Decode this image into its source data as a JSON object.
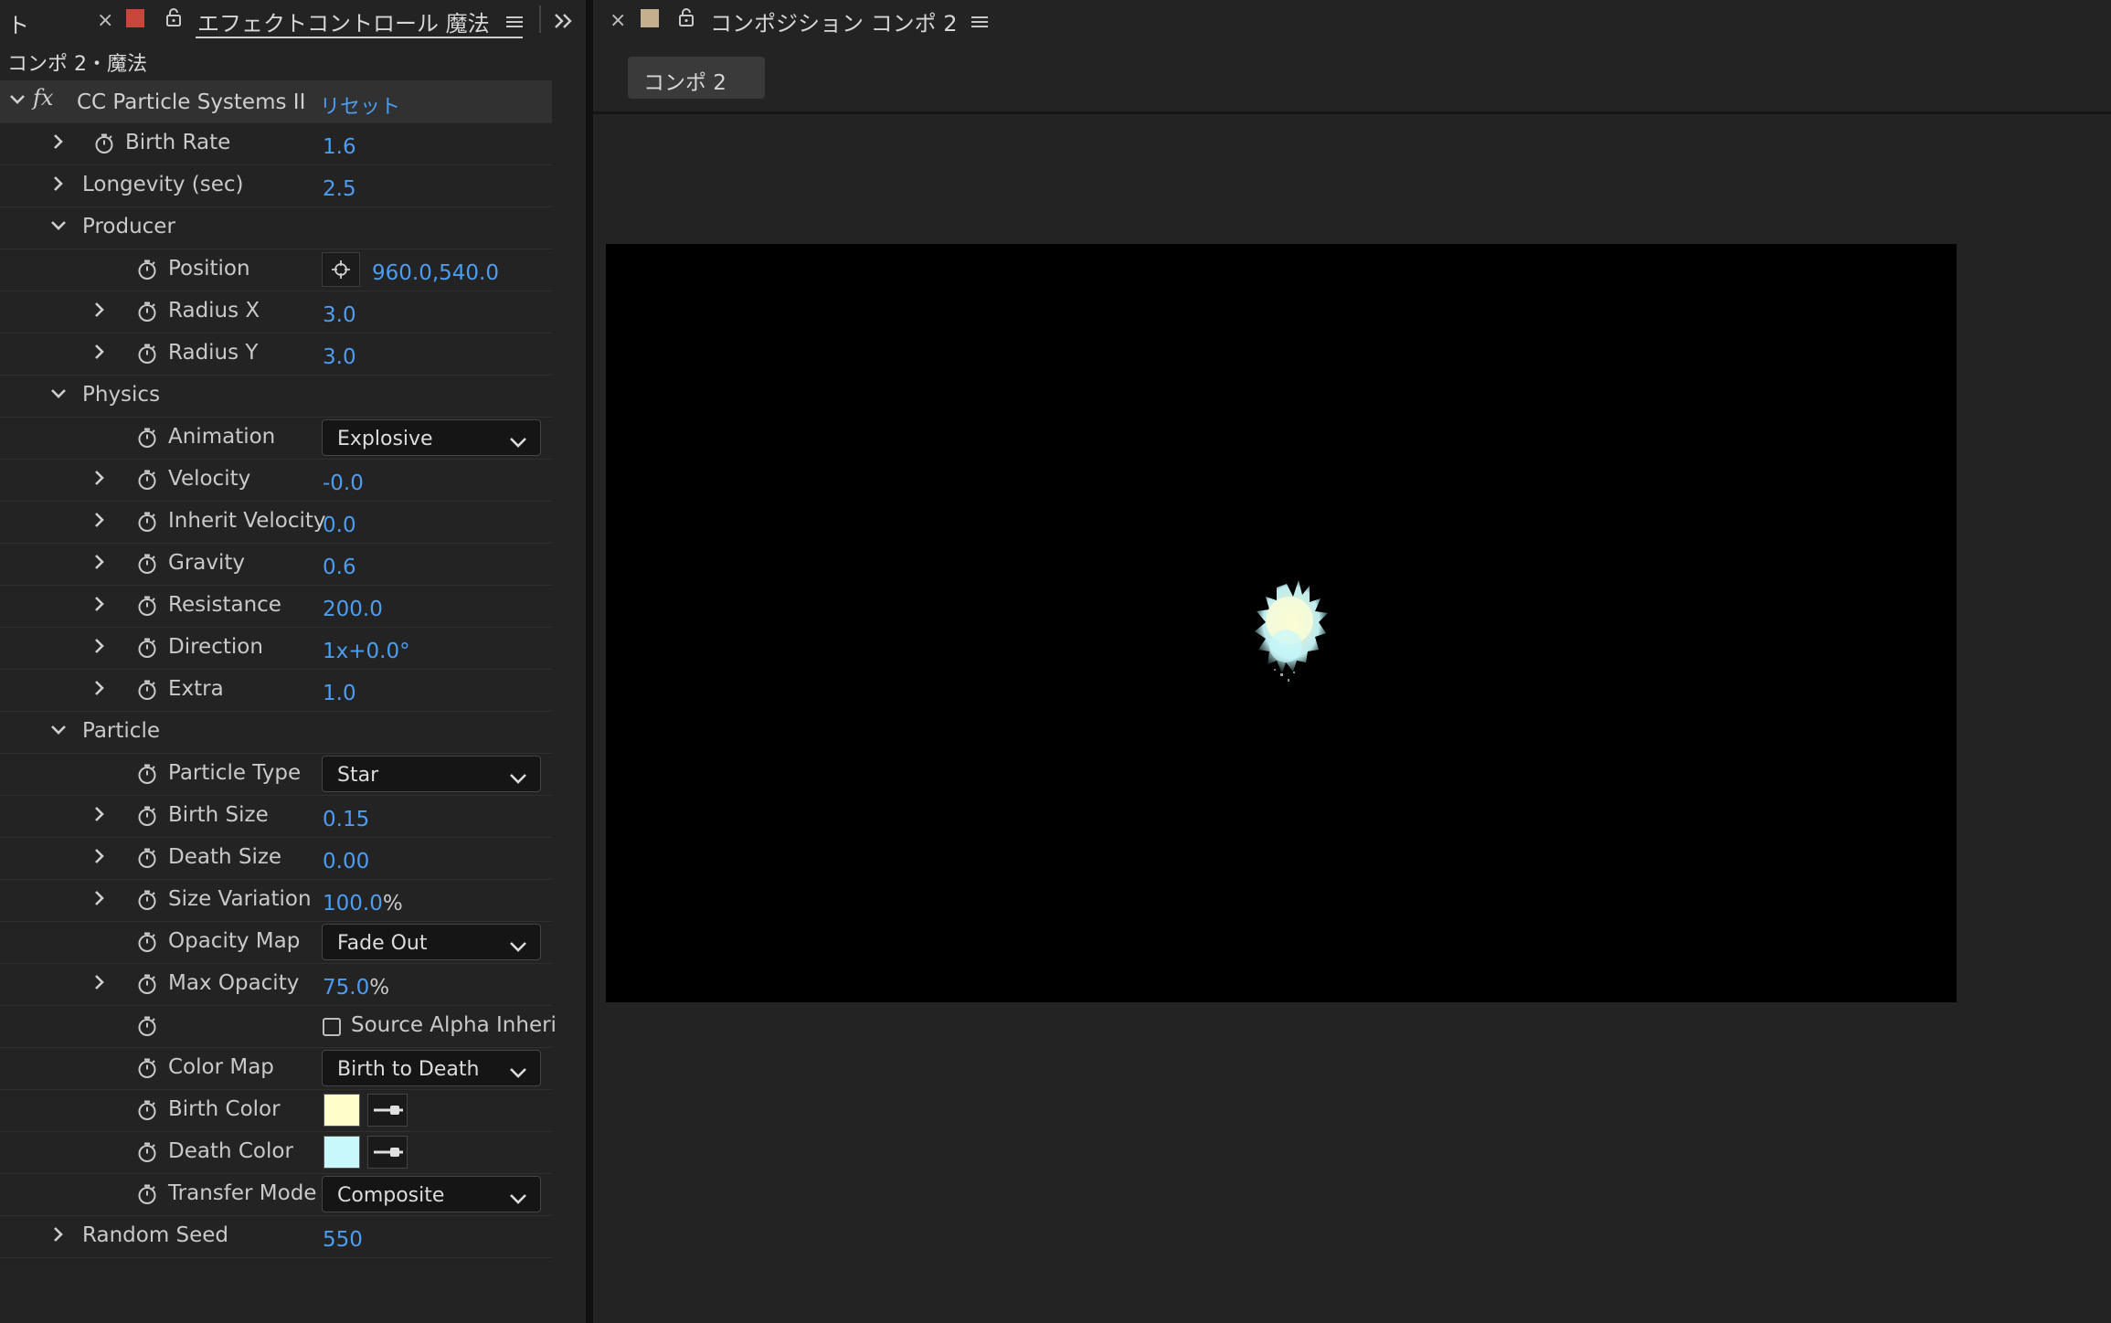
{
  "left_panel": {
    "tab_stub": "ト",
    "tab_title": "エフェクトコントロール 魔法",
    "breadcrumb": "コンポ 2・魔法",
    "effect_name": "CC Particle Systems II",
    "reset_label": "リセット",
    "label_color": "#c8463c",
    "value_color": "#4d9cf0",
    "properties": [
      {
        "name": "Birth Rate",
        "value": "1.6"
      },
      {
        "name": "Longevity (sec)",
        "value": "2.5"
      },
      {
        "name": "Producer"
      },
      {
        "name": "Position",
        "value": "960.0,540.0"
      },
      {
        "name": "Radius X",
        "value": "3.0"
      },
      {
        "name": "Radius Y",
        "value": "3.0"
      },
      {
        "name": "Physics"
      },
      {
        "name": "Animation",
        "value": "Explosive"
      },
      {
        "name": "Velocity",
        "value": "-0.0"
      },
      {
        "name": "Inherit Velocity",
        "value": "0.0"
      },
      {
        "name": "Gravity",
        "value": "0.6"
      },
      {
        "name": "Resistance",
        "value": "200.0"
      },
      {
        "name": "Direction",
        "value": "1x+0.0°"
      },
      {
        "name": "Extra",
        "value": "1.0"
      },
      {
        "name": "Particle"
      },
      {
        "name": "Particle Type",
        "value": "Star"
      },
      {
        "name": "Birth Size",
        "value": "0.15"
      },
      {
        "name": "Death Size",
        "value": "0.00"
      },
      {
        "name": "Size Variation",
        "value": "100.0",
        "unit": "%"
      },
      {
        "name": "Opacity Map",
        "value": "Fade Out"
      },
      {
        "name": "Max Opacity",
        "value": "75.0",
        "unit": "%"
      },
      {
        "name": "Source Alpha Inheri"
      },
      {
        "name": "Color Map",
        "value": "Birth to Death"
      },
      {
        "name": "Birth Color",
        "color": "#ffffcc"
      },
      {
        "name": "Death Color",
        "color": "#c8f8fc"
      },
      {
        "name": "Transfer Mode",
        "value": "Composite"
      },
      {
        "name": "Random Seed",
        "value": "550"
      }
    ]
  },
  "right_panel": {
    "tab_title": "コンポジション コンポ 2",
    "label_color": "#c4b08c",
    "comp_tab_label": "コンポ 2",
    "canvas_color": "#000000",
    "particle_colors": [
      "#ffffcc",
      "#c8f8fc"
    ]
  },
  "icons": [
    "close-icon",
    "lock-icon",
    "menu-icon",
    "double-chevron-icon",
    "fx-icon",
    "chevron-right-icon",
    "chevron-down-icon",
    "stopwatch-icon",
    "crosshair-icon",
    "eyedropper-icon"
  ]
}
